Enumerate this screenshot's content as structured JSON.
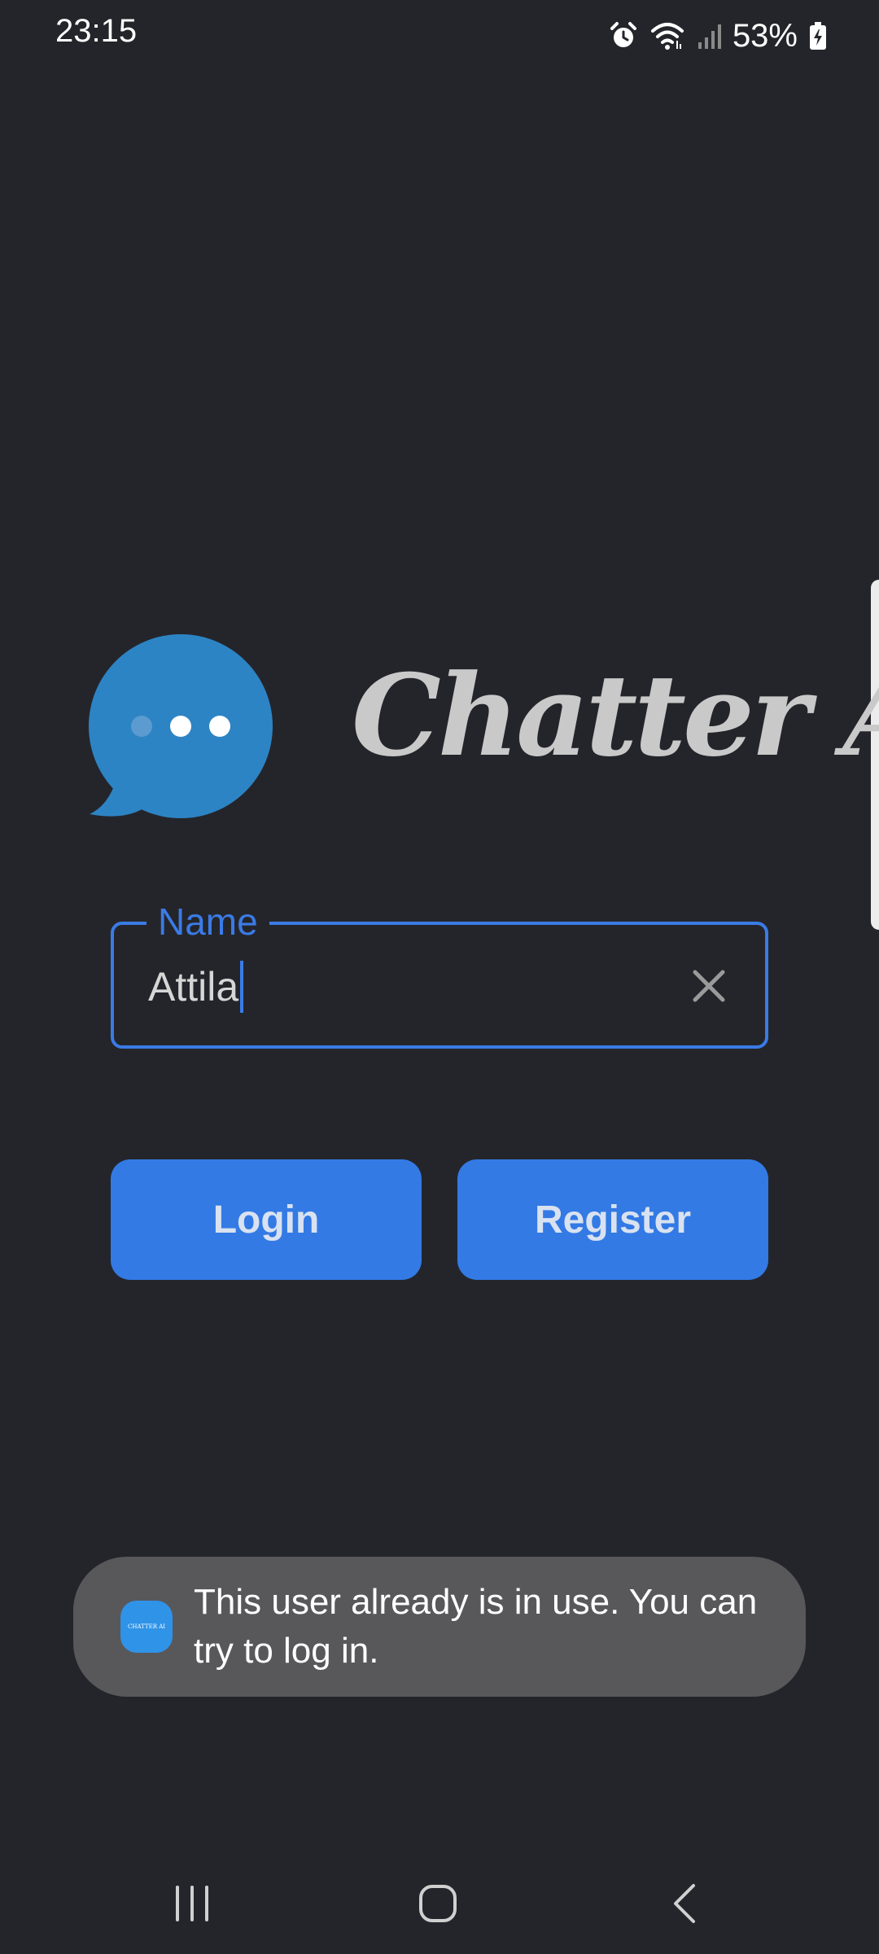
{
  "status_bar": {
    "time": "23:15",
    "battery_percent": "53%",
    "icons": [
      "alarm-icon",
      "wifi-icon",
      "signal-icon",
      "battery-charging-icon"
    ]
  },
  "app": {
    "title": "Chatter AI",
    "logo_icon": "chat-bubble-icon",
    "brand_color": "#2d84c4",
    "accent_color": "#3a7be6"
  },
  "name_field": {
    "label": "Name",
    "value": "Attila",
    "clear_icon": "close-icon"
  },
  "buttons": {
    "login_label": "Login",
    "register_label": "Register"
  },
  "toast": {
    "message": "This user already is in use. You can try to log in.",
    "icon_text": "CHATTER AI"
  },
  "nav_bar": {
    "icons": [
      "recents-icon",
      "home-icon",
      "back-icon"
    ]
  }
}
